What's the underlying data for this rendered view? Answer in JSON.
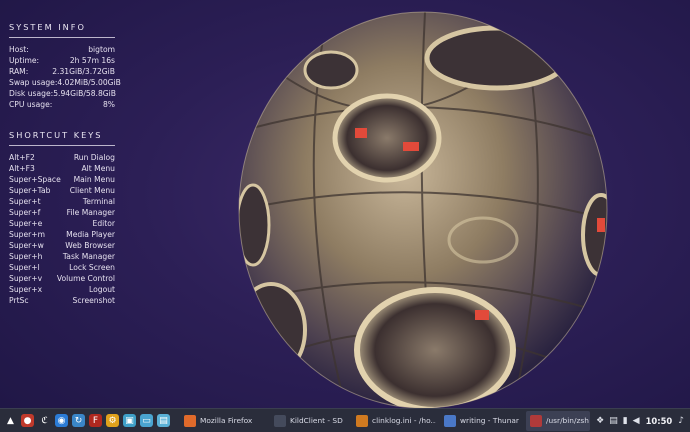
{
  "system_info": {
    "title": "SYSTEM INFO",
    "rows": [
      {
        "label": "Host:",
        "value": "bigtom"
      },
      {
        "label": "Uptime:",
        "value": "2h 57m 16s"
      },
      {
        "label": "RAM:",
        "value": "2.31GiB/3.72GiB"
      },
      {
        "label": "Swap usage:",
        "value": "4.02MiB/5.00GiB"
      },
      {
        "label": "Disk usage:",
        "value": "5.94GiB/58.8GiB"
      },
      {
        "label": "CPU usage:",
        "value": "8%"
      }
    ]
  },
  "shortcut_keys": {
    "title": "SHORTCUT KEYS",
    "rows": [
      {
        "key": "Alt+F2",
        "action": "Run Dialog"
      },
      {
        "key": "Alt+F3",
        "action": "Alt Menu"
      },
      {
        "key": "Super+Space",
        "action": "Main Menu"
      },
      {
        "key": "Super+Tab",
        "action": "Client Menu"
      },
      {
        "key": "Super+t",
        "action": "Terminal"
      },
      {
        "key": "Super+f",
        "action": "File Manager"
      },
      {
        "key": "Super+e",
        "action": "Editor"
      },
      {
        "key": "Super+m",
        "action": "Media Player"
      },
      {
        "key": "Super+w",
        "action": "Web Browser"
      },
      {
        "key": "Super+h",
        "action": "Task Manager"
      },
      {
        "key": "Super+l",
        "action": "Lock Screen"
      },
      {
        "key": "Super+v",
        "action": "Volume Control"
      },
      {
        "key": "Super+x",
        "action": "Logout"
      },
      {
        "key": "PrtSc",
        "action": "Screenshot"
      }
    ]
  },
  "taskbar": {
    "launchers": [
      {
        "icon": "arch-menu-icon",
        "color": "#2a2d3b",
        "glyph": "▲"
      },
      {
        "icon": "app-red-icon",
        "color": "#c0392b",
        "glyph": "●"
      },
      {
        "icon": "dino-icon",
        "color": "#2a2d3b",
        "glyph": "ℭ"
      },
      {
        "icon": "network-icon",
        "color": "#2b7bd6",
        "glyph": "◉"
      },
      {
        "icon": "refresh-icon",
        "color": "#3a86c8",
        "glyph": "↻"
      },
      {
        "icon": "filezilla-icon",
        "color": "#b0281f",
        "glyph": "F"
      },
      {
        "icon": "settings-icon",
        "color": "#e0a21c",
        "glyph": "⚙"
      },
      {
        "icon": "image-viewer-icon",
        "color": "#3fa0c8",
        "glyph": "▣"
      },
      {
        "icon": "monitor-icon",
        "color": "#4aa4d0",
        "glyph": "▭"
      },
      {
        "icon": "screenshot-icon",
        "color": "#5ab0d6",
        "glyph": "▤"
      }
    ],
    "tasks": [
      {
        "label": "Mozilla Firefox",
        "icon": "firefox-icon",
        "color": "#e06a2b",
        "active": false
      },
      {
        "label": "KildClient - SD",
        "icon": "kildclient-icon",
        "color": "#444a5c",
        "active": false
      },
      {
        "label": "clinklog.ini - /ho...",
        "icon": "editor-icon",
        "color": "#d07a20",
        "active": false
      },
      {
        "label": "writing - Thunar",
        "icon": "folder-icon",
        "color": "#4a78c8",
        "active": false
      },
      {
        "label": "/usr/bin/zsh",
        "icon": "terminal-icon",
        "color": "#b03a3a",
        "active": true
      }
    ],
    "tray": [
      "dropbox-icon",
      "clipboard-icon",
      "battery-icon",
      "volume-icon",
      "notifications-icon"
    ],
    "clock": "10:50",
    "bell_glyph": "🔔"
  }
}
